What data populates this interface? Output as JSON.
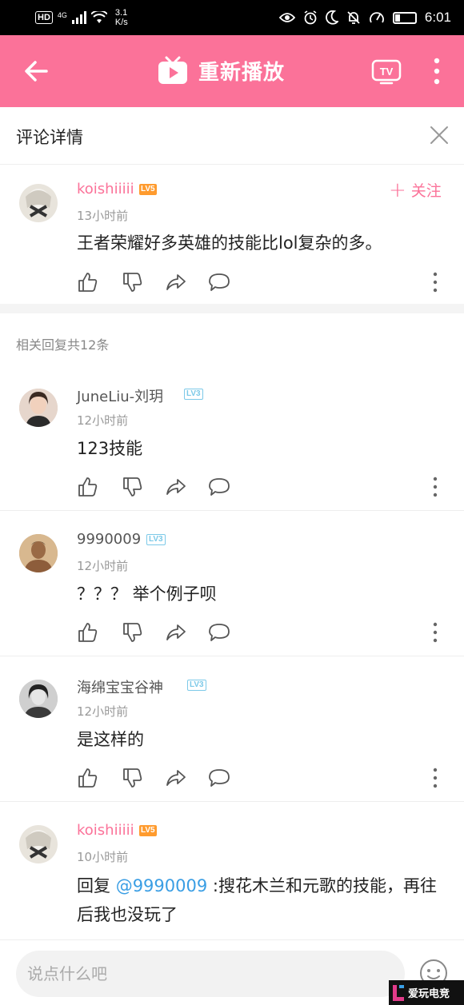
{
  "status_bar": {
    "hd": "HD",
    "network": "4G",
    "speed_value": "3.1",
    "speed_unit": "K/s",
    "time": "6:01",
    "battery_level": 0.22
  },
  "app_bar": {
    "title": "重新播放",
    "tv_label": "TV"
  },
  "panel": {
    "title": "评论详情"
  },
  "main_comment": {
    "username": "koishiiiii",
    "level": "LV5",
    "time": "13小时前",
    "content": "王者荣耀好多英雄的技能比lol复杂的多。",
    "follow_label": "关注"
  },
  "replies_header": "相关回复共12条",
  "replies": [
    {
      "username": "JuneLiu-刘玥",
      "level": "LV3",
      "time": "12小时前",
      "content": "123技能"
    },
    {
      "username": "9990009",
      "level": "LV3",
      "time": "12小时前",
      "content": "？？？ 举个例子呗"
    },
    {
      "username": "海绵宝宝谷神",
      "level": "LV3",
      "time": "12小时前",
      "content": "是这样的"
    },
    {
      "username": "koishiiiii",
      "level": "LV5",
      "time": "10小时前",
      "reply_prefix": "回复 ",
      "mention": "@9990009",
      "content": " :搜花木兰和元歌的技能，再往后我也没玩了"
    }
  ],
  "input": {
    "placeholder": "说点什么吧"
  },
  "watermark": {
    "text": "爱玩电竞"
  },
  "colors": {
    "accent": "#fb7299",
    "mention": "#3a9ee4",
    "level5": "#ff9b2e",
    "level3": "#7cc9e8"
  },
  "icons": {
    "like": "thumbs-up-icon",
    "dislike": "thumbs-down-icon",
    "share": "share-icon",
    "comment": "comment-bubble-icon",
    "more": "more-vertical-icon"
  }
}
